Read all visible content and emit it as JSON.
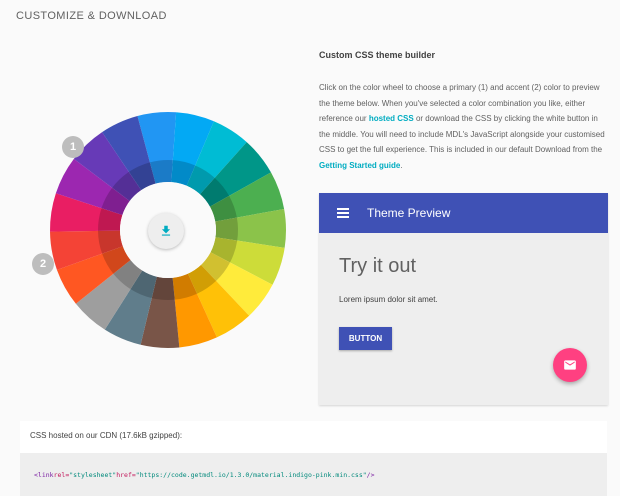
{
  "section": {
    "title": "CUSTOMIZE & DOWNLOAD"
  },
  "wheel": {
    "markers": [
      "1",
      "2"
    ],
    "download_icon": "download-icon",
    "colors": [
      "#2196f3",
      "#03a9f4",
      "#00bcd4",
      "#009688",
      "#4caf50",
      "#8bc34a",
      "#cddc39",
      "#ffeb3b",
      "#ffc107",
      "#ff9800",
      "#795548",
      "#607d8b",
      "#9e9e9e",
      "#ff5722",
      "#f44336",
      "#e91e63",
      "#9c27b0",
      "#673ab7",
      "#3f51b5"
    ]
  },
  "builder": {
    "heading": "Custom CSS theme builder",
    "p1": "Click on the color wheel to choose a primary (1) and accent (2) color to preview the theme below. When you've selected a color combination you like, either reference our ",
    "link1": "hosted CSS",
    "p2": " or download the CSS by clicking the white button in the middle. You will need to include MDL's JavaScript alongside your customised CSS to get the full experience. This is included in our default Download from the ",
    "link2": "Getting Started guide",
    "p3": "."
  },
  "preview": {
    "title": "Theme Preview",
    "heading": "Try it out",
    "text": "Lorem ipsum dolor sit amet.",
    "button": "BUTTON",
    "primary": "#3f51b5",
    "accent": "#ff4081",
    "menu_icon": "menu-icon",
    "fab_icon": "mail-icon"
  },
  "cdn": {
    "label": "CSS hosted on our CDN (17.6kB gzipped):",
    "code": {
      "open": "<link",
      "a1": " rel=",
      "v1": "\"stylesheet\"",
      "a2": " href=",
      "v2": "\"https://code.getmdl.io/1.3.0/material.indigo-pink.min.css\"",
      "close": " />"
    }
  }
}
